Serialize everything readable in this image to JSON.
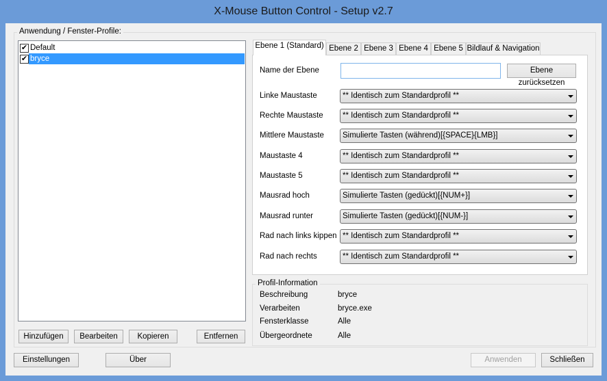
{
  "window": {
    "title": "X-Mouse Button Control - Setup v2.7"
  },
  "profiles": {
    "group_label": "Anwendung / Fenster-Profile:",
    "items": [
      {
        "label": "Default",
        "checked": true
      },
      {
        "label": "bryce",
        "checked": true,
        "selected": true
      }
    ],
    "buttons": {
      "add": "Hinzufügen",
      "edit": "Bearbeiten",
      "copy": "Kopieren",
      "remove": "Entfernen"
    }
  },
  "tabs": [
    "Ebene 1 (Standard)",
    "Ebene 2",
    "Ebene 3",
    "Ebene 4",
    "Ebene 5",
    "Bildlauf & Navigation"
  ],
  "layer": {
    "name_label": "Name der Ebene",
    "name_value": "",
    "reset_button": "Ebene zurücksetzen",
    "rows": [
      {
        "label": "Linke Maustaste",
        "value": "** Identisch zum Standardprofil **"
      },
      {
        "label": "Rechte Maustaste",
        "value": "** Identisch zum Standardprofil **"
      },
      {
        "label": "Mittlere Maustaste",
        "value": "Simulierte Tasten (während)[{SPACE}{LMB}]"
      },
      {
        "label": "Maustaste 4",
        "value": "** Identisch zum Standardprofil **"
      },
      {
        "label": "Maustaste 5",
        "value": "** Identisch zum Standardprofil **"
      },
      {
        "label": "Mausrad hoch",
        "value": "Simulierte Tasten (gedückt)[{NUM+}]"
      },
      {
        "label": "Mausrad runter",
        "value": "Simulierte Tasten (gedückt)[{NUM-}]"
      },
      {
        "label": "Rad nach links kippen",
        "value": "** Identisch zum Standardprofil **"
      },
      {
        "label": "Rad nach rechts",
        "value": "** Identisch zum Standardprofil **"
      }
    ]
  },
  "info": {
    "group_label": "Profil-Information",
    "rows": [
      {
        "label": "Beschreibung",
        "value": "bryce"
      },
      {
        "label": "Verarbeiten",
        "value": "bryce.exe"
      },
      {
        "label": "Fensterklasse",
        "value": "Alle"
      },
      {
        "label": "Übergeordnete",
        "value": "Alle"
      }
    ]
  },
  "footer": {
    "settings": "Einstellungen",
    "about": "Über",
    "apply": "Anwenden",
    "close": "Schließen"
  }
}
